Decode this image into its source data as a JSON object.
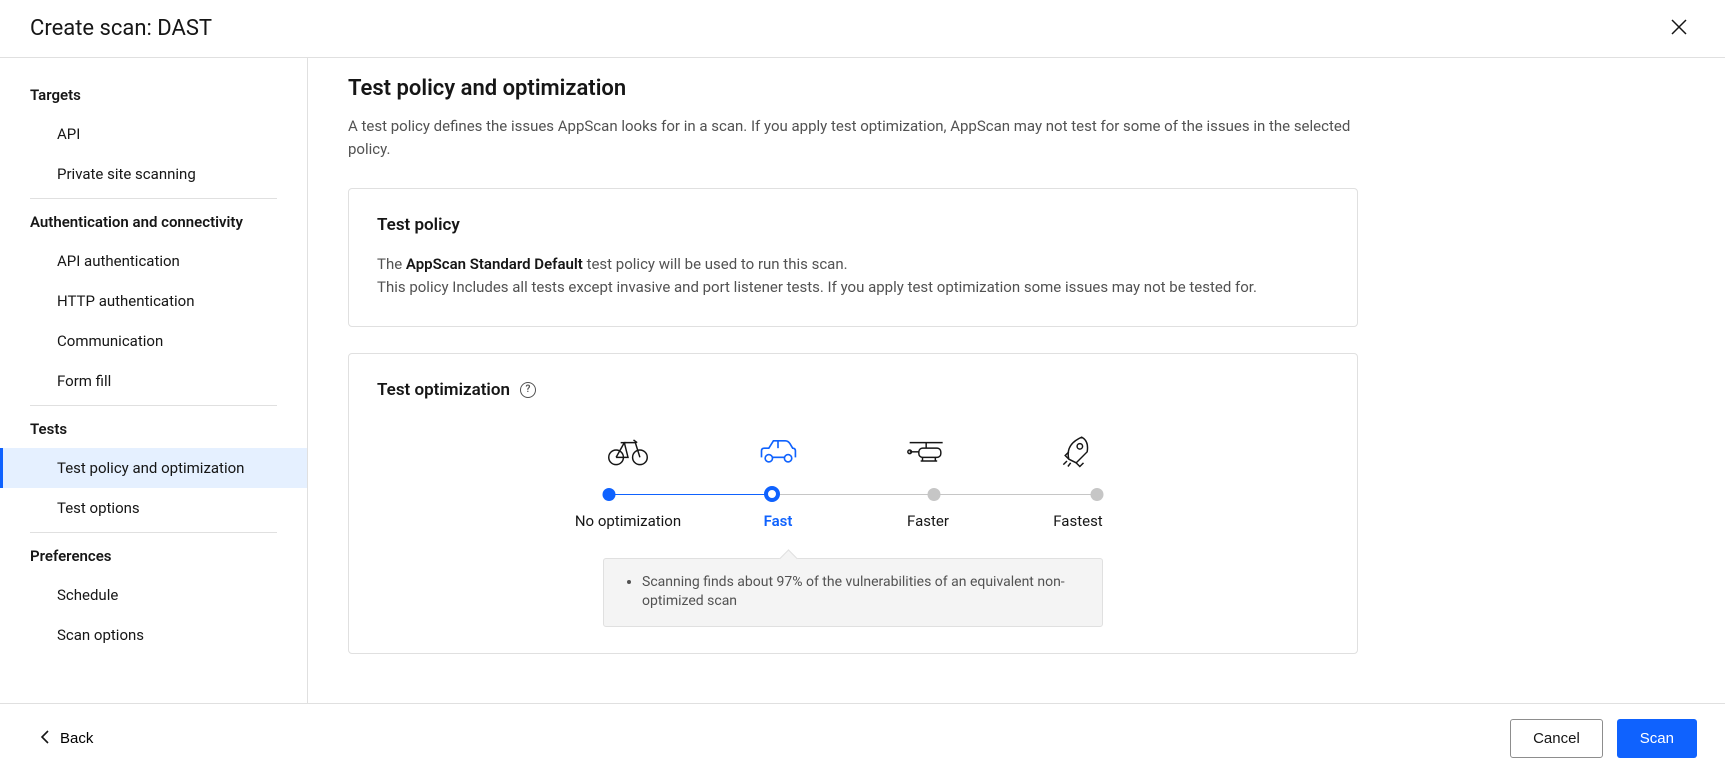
{
  "header": {
    "title": "Create scan: DAST"
  },
  "sidebar": {
    "groups": [
      {
        "title": "Targets",
        "items": [
          "API",
          "Private site scanning"
        ]
      },
      {
        "title": "Authentication and connectivity",
        "items": [
          "API authentication",
          "HTTP authentication",
          "Communication",
          "Form fill"
        ]
      },
      {
        "title": "Tests",
        "items": [
          "Test policy and optimization",
          "Test options"
        ]
      },
      {
        "title": "Preferences",
        "items": [
          "Schedule",
          "Scan options"
        ]
      }
    ],
    "active": "Test policy and optimization"
  },
  "main": {
    "title": "Test policy and optimization",
    "intro": "A test policy defines the issues AppScan looks for in a scan. If you apply test optimization, AppScan may not test for some of the issues in the selected policy.",
    "testPolicy": {
      "heading": "Test policy",
      "line1_pre": "The ",
      "line1_bold": "AppScan Standard Default",
      "line1_post": " test policy will be used to run this scan.",
      "line2": "This policy Includes all tests except invasive and port listener tests. If you apply test optimization some issues may not be tested for."
    },
    "testOptimization": {
      "heading": "Test optimization",
      "levels": [
        "No optimization",
        "Fast",
        "Faster",
        "Fastest"
      ],
      "selectedIndex": 1,
      "tooltip": "Scanning finds about 97% of the vulnerabilities of an equivalent non-optimized scan"
    }
  },
  "footer": {
    "back": "Back",
    "cancel": "Cancel",
    "scan": "Scan"
  }
}
